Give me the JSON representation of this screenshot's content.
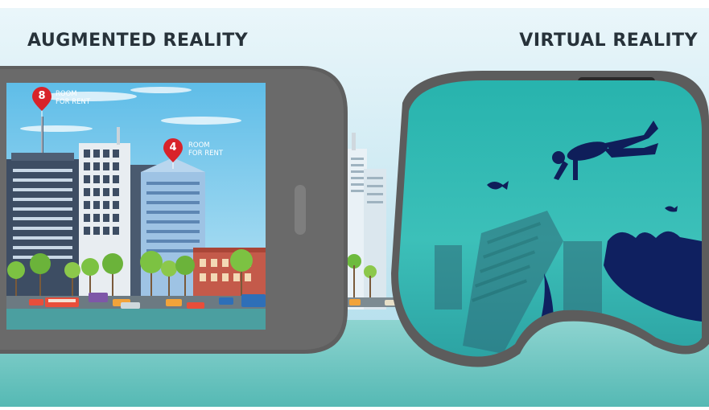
{
  "ar_heading": "AUGMENTED REALITY",
  "vr_heading": "VIRTUAL REALITY",
  "pins": [
    {
      "number": "8",
      "label_line1": "ROOM",
      "label_line2": "FOR RENT"
    },
    {
      "number": "4",
      "label_line1": "ROOM",
      "label_line2": "FOR RENT"
    }
  ],
  "colors": {
    "sky_top": "#dff1f7",
    "sky_bottom": "#bfe3ef",
    "pin_red": "#d8232a",
    "device_gray": "#5d5d5d",
    "water_teal": "#2fb7b3",
    "heading_text": "#27323a"
  },
  "icons": [
    "location-pin-icon",
    "scuba-diver-icon",
    "fish-icon"
  ]
}
